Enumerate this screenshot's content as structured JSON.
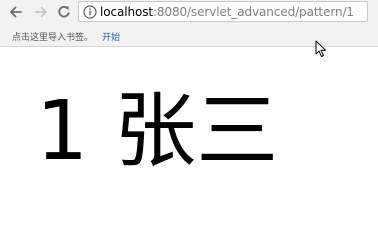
{
  "browser": {
    "address_bar": {
      "host": "localhost",
      "rest": ":8080/servlet_advanced/pattern/1"
    },
    "bookmarks_bar": {
      "hint": "点击这里导入书签。",
      "link": "开始"
    },
    "icons": {
      "back": "arrow-left",
      "forward": "arrow-right",
      "reload": "reload",
      "site_info": "info-circle",
      "cursor": "arrow-pointer"
    }
  },
  "page": {
    "text": "1 张三"
  }
}
